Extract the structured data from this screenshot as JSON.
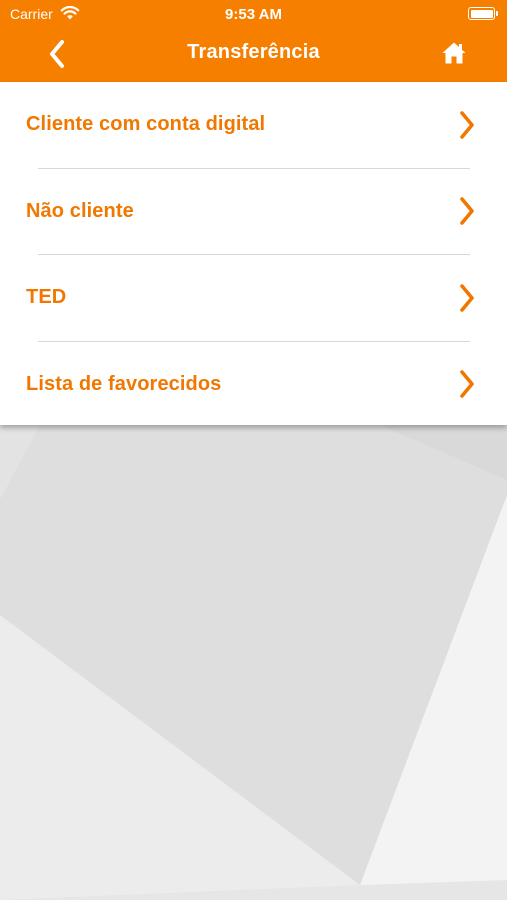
{
  "status_bar": {
    "carrier": "Carrier",
    "time": "9:53 AM"
  },
  "nav": {
    "title": "Transferência",
    "back_icon": "chevron-left-icon",
    "home_icon": "home-icon"
  },
  "menu": {
    "items": [
      {
        "label": "Cliente com conta digital"
      },
      {
        "label": "Não cliente"
      },
      {
        "label": "TED"
      },
      {
        "label": "Lista de favorecidos"
      }
    ]
  },
  "colors": {
    "brand_orange": "#f77f00",
    "label_orange": "#f07800",
    "chevron_orange": "#f07800"
  }
}
